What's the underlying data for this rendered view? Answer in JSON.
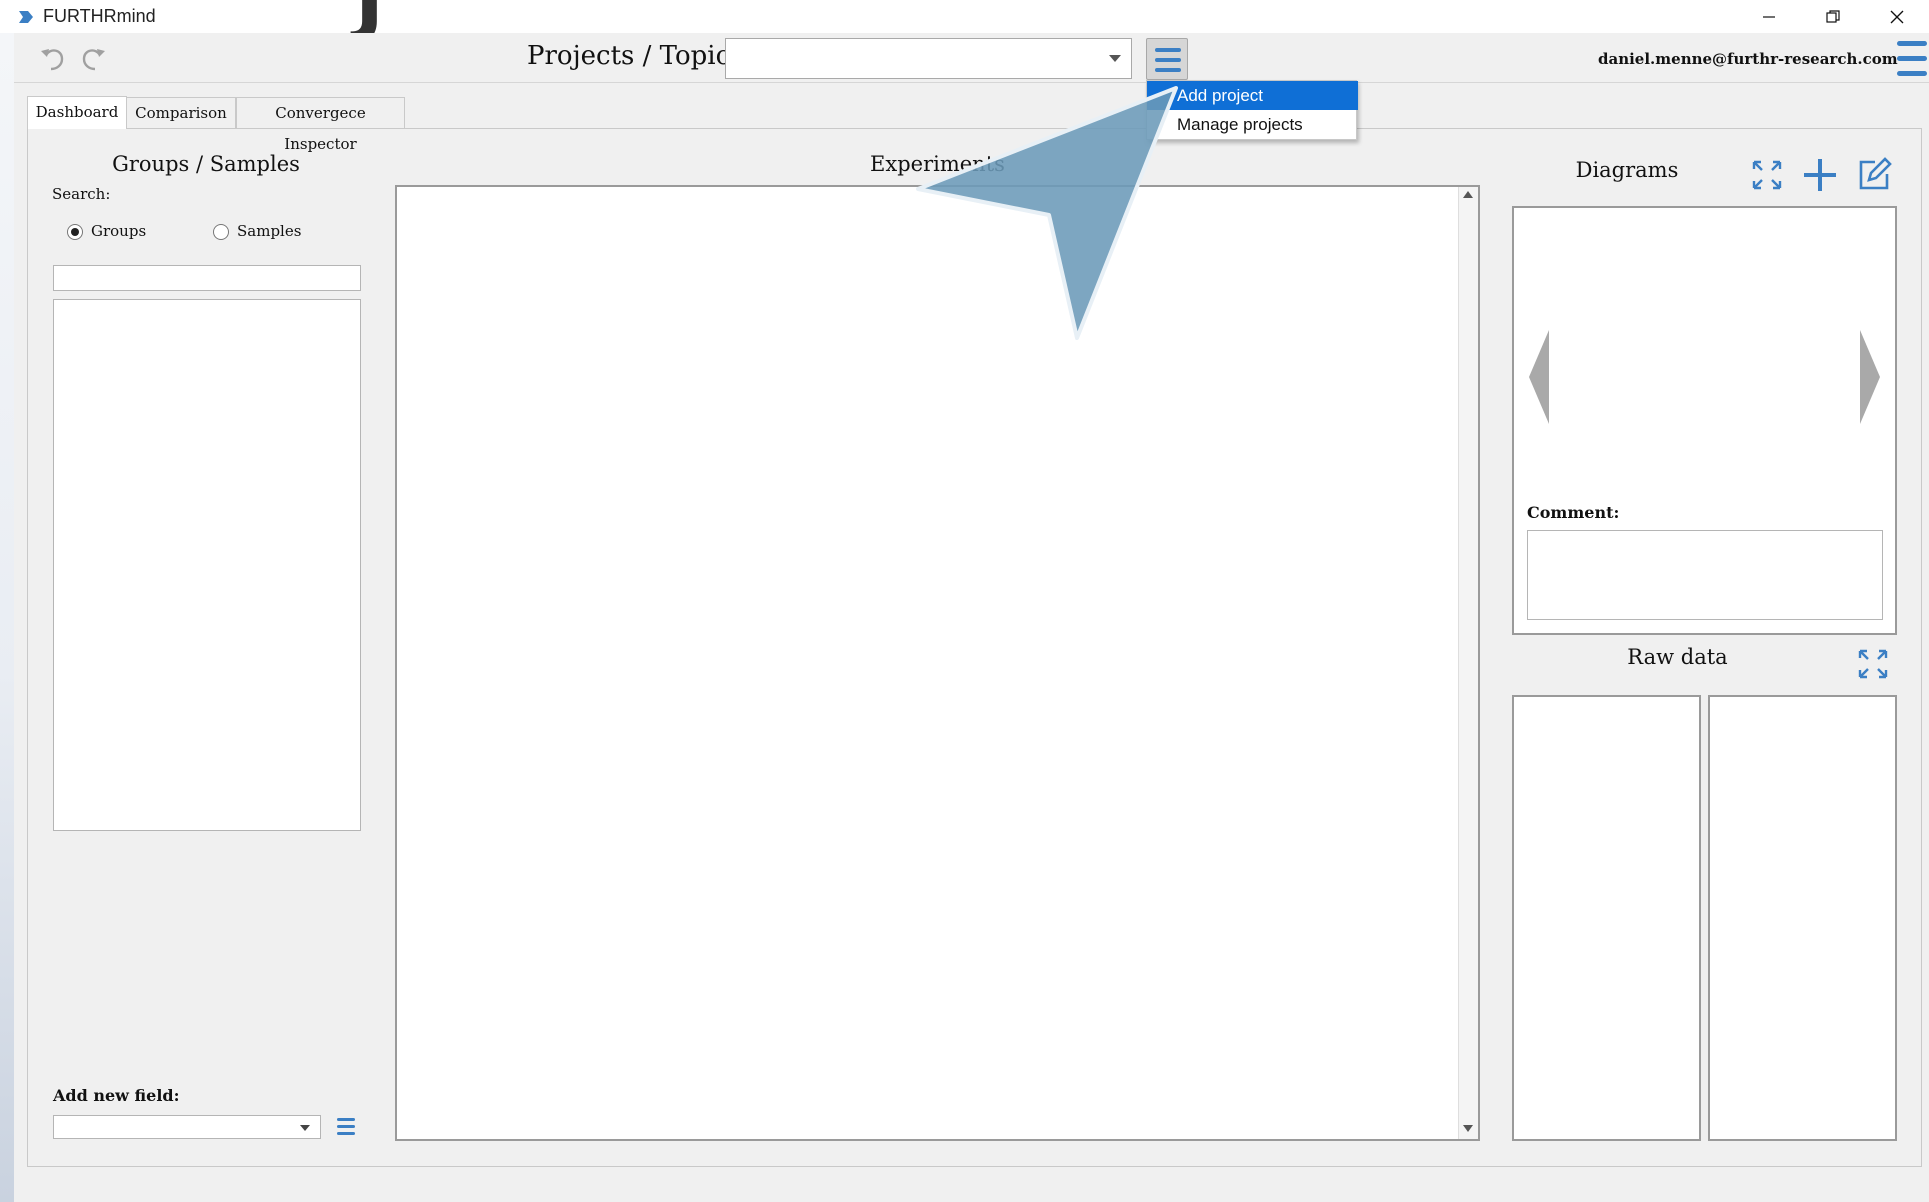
{
  "window": {
    "title": "FURTHRmind",
    "decor_glyph": "J"
  },
  "toolbar": {
    "projects_label": "Projects / Topics",
    "project_selected": "",
    "user_email": "daniel.menne@furthr-research.com"
  },
  "projects_menu": {
    "items": [
      {
        "label": "Add project",
        "highlighted": true
      },
      {
        "label": "Manage projects",
        "highlighted": false
      }
    ]
  },
  "tabs": [
    {
      "label": "Dashboard",
      "active": true
    },
    {
      "label": "Comparison",
      "active": false
    },
    {
      "label": "Convergece Inspector",
      "active": false
    }
  ],
  "left_panel": {
    "title": "Groups / Samples",
    "search_label": "Search:",
    "radio": [
      {
        "label": "Groups",
        "checked": true
      },
      {
        "label": "Samples",
        "checked": false
      }
    ],
    "search_value": "",
    "add_field_label": "Add new field:",
    "field_selected": ""
  },
  "experiments": {
    "title": "Experiments"
  },
  "diagrams": {
    "title": "Diagrams",
    "comment_label": "Comment:",
    "comment_value": ""
  },
  "raw_data": {
    "title": "Raw data"
  },
  "colors": {
    "accent": "#0f6fd6",
    "icon_blue": "#3b7fc4",
    "pointer_arrow": "#6b9ab8"
  }
}
